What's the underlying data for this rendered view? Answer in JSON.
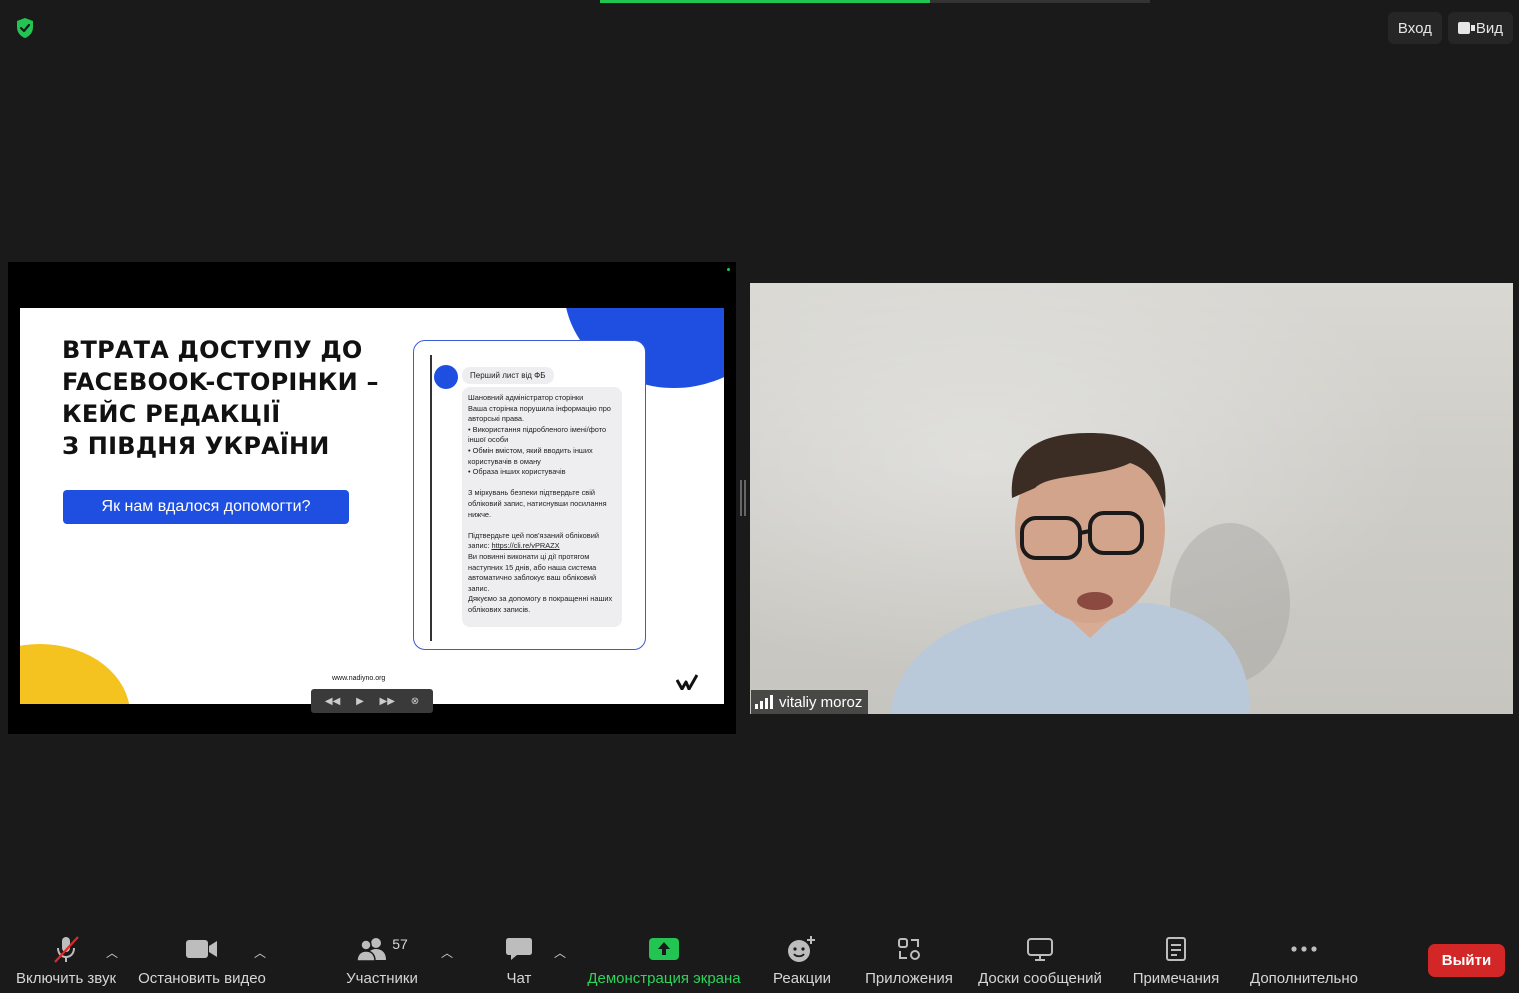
{
  "top_bar": {
    "enter_label": "Вход",
    "view_label": "Вид"
  },
  "shared_slide": {
    "title": "ВТРАТА ДОСТУПУ ДО\nFACEBOOK-СТОРІНКИ –\nКЕЙС РЕДАКЦІЇ\nЗ ПІВДНЯ УКРАЇНИ",
    "button_label": "Як нам вдалося допомогти?",
    "url": "www.nadiyno.org",
    "sender": "Перший лист від ФБ",
    "message": "Шановний адміністратор сторінки\nВаша сторінка порушила інформацію про авторські права.\n• Використання підробленого імені/фото іншої особи\n• Обмін вмістом, який вводить інших користувачів в оману\n• Образа інших користувачів\n\nЗ міркувань безпеки підтвердьте свій обліковий запис, натиснувши посилання нижче.\n\nПідтвердьте цей пов'язаний обліковий запис: ",
    "link": "https://cli.re/vPRAZX",
    "message_end": "\nВи повинні виконати ці дії протягом наступних 15 днів, або наша система автоматично заблокує ваш обліковий запис.\nДякуємо за допомогу в покращенні наших облікових записів."
  },
  "participant": {
    "name": "vitaliy moroz"
  },
  "toolbar": {
    "mute_label": "Включить звук",
    "video_label": "Остановить видео",
    "participants_label": "Участники",
    "participants_count": "57",
    "chat_label": "Чат",
    "share_label": "Демонстрация экрана",
    "reactions_label": "Реакции",
    "apps_label": "Приложения",
    "whiteboards_label": "Доски сообщений",
    "notes_label": "Примечания",
    "more_label": "Дополнительно",
    "leave_label": "Выйти"
  },
  "colors": {
    "accent_green": "#23c552",
    "leave_red": "#d32727",
    "slide_blue": "#1e4fe0",
    "slide_yellow": "#f5c320"
  }
}
